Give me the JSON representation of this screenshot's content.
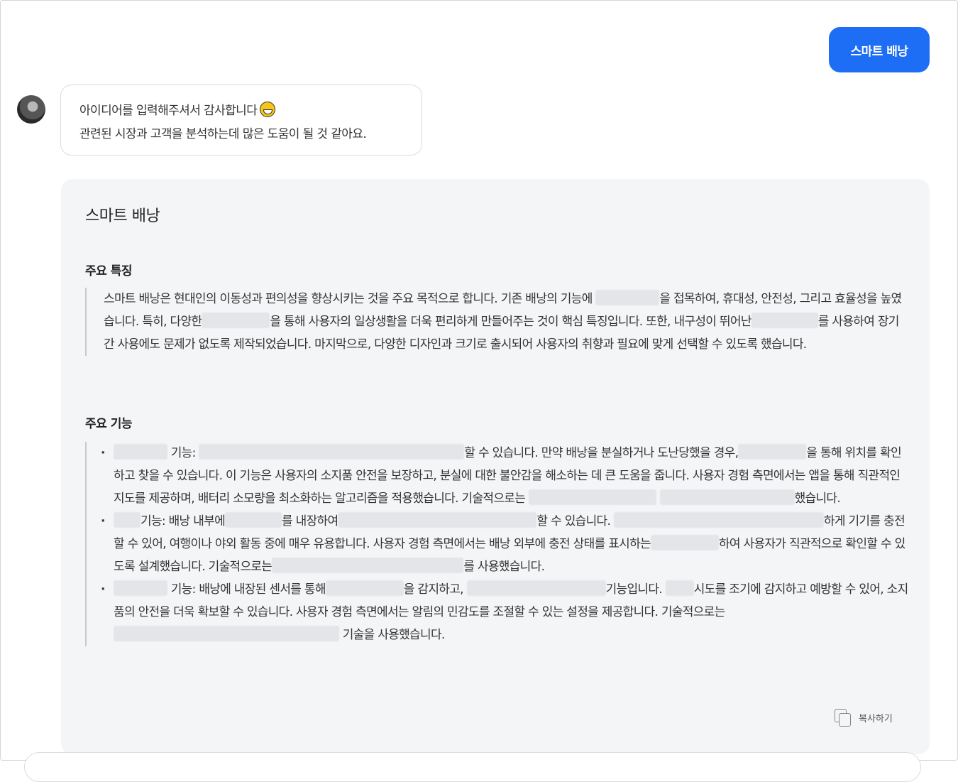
{
  "user_message": {
    "text": "스마트 배낭"
  },
  "bot_message": {
    "line1": "아이디어를 입력해주셔서 감사합니다",
    "emoji": "grinning-face-icon",
    "line2": "관련된 시장과 고객을 분석하는데 많은 도움이 될 것 같아요."
  },
  "card": {
    "title": "스마트 배낭",
    "section1": {
      "heading": "주요 특징",
      "p_a": "스마트 배낭은 현대인의 이동성과 편의성을 향상시키는 것을 주요 목적으로 합니다. 기존 배낭의 기능에 ",
      "p_b": "을 접목하여, 휴대성, 안전성, 그리고 효율성을 높였습니다. 특히, 다양한",
      "p_c": "을 통해 사용자의 일상생활을 더욱 편리하게 만들어주는 것이 핵심 특징입니다. 또한, 내구성이 뛰어난",
      "p_d": "를 사용하여 장기간 사용에도 문제가 없도록 제작되었습니다. 마지막으로, 다양한 디자인과 크기로 출시되어 사용자의 취향과 필요에 맞게 선택할 수 있도록 했습니다."
    },
    "section2": {
      "heading": "주요 기능",
      "item1": {
        "a": "기능: ",
        "b": "할 수 있습니다. 만약 배낭을 분실하거나 도난당했을 경우,",
        "c": "을 통해 위치를 확인하고 찾을 수 있습니다. 이 기능은 사용자의 소지품 안전을 보장하고, 분실에 대한 불안감을 해소하는 데 큰 도움을 줍니다. 사용자 경험 측면에서는 앱을 통해 직관적인 지도를 제공하며, 배터리 소모량을 최소화하는 알고리즘을 적용했습니다. 기술적으로는 ",
        "d": "했습니다."
      },
      "item2": {
        "a": "기능: 배낭 내부에",
        "b": "를 내장하여",
        "c": "할 수 있습니다. ",
        "d": "하게 기기를 충전할 수 있어, 여행이나 야외 활동 중에 매우 유용합니다. 사용자 경험 측면에서는 배낭 외부에 충전 상태를 표시하는",
        "e": "하여 사용자가 직관적으로 확인할 수 있도록 설계했습니다. 기술적으로는",
        "f": "를 사용했습니다."
      },
      "item3": {
        "a": "기능: 배낭에 내장된 센서를 통해",
        "b": "을 감지하고, ",
        "c": "기능입니다. ",
        "d": "시도를 조기에 감지하고 예방할 수 있어, 소지품의 안전을 더욱 확보할 수 있습니다. 사용자 경험 측면에서는 알림의 민감도를 조절할 수 있는 설정을 제공합니다. 기술적으로는",
        "e": "기술을 사용했습니다."
      }
    },
    "copy_label": "복사하기"
  }
}
